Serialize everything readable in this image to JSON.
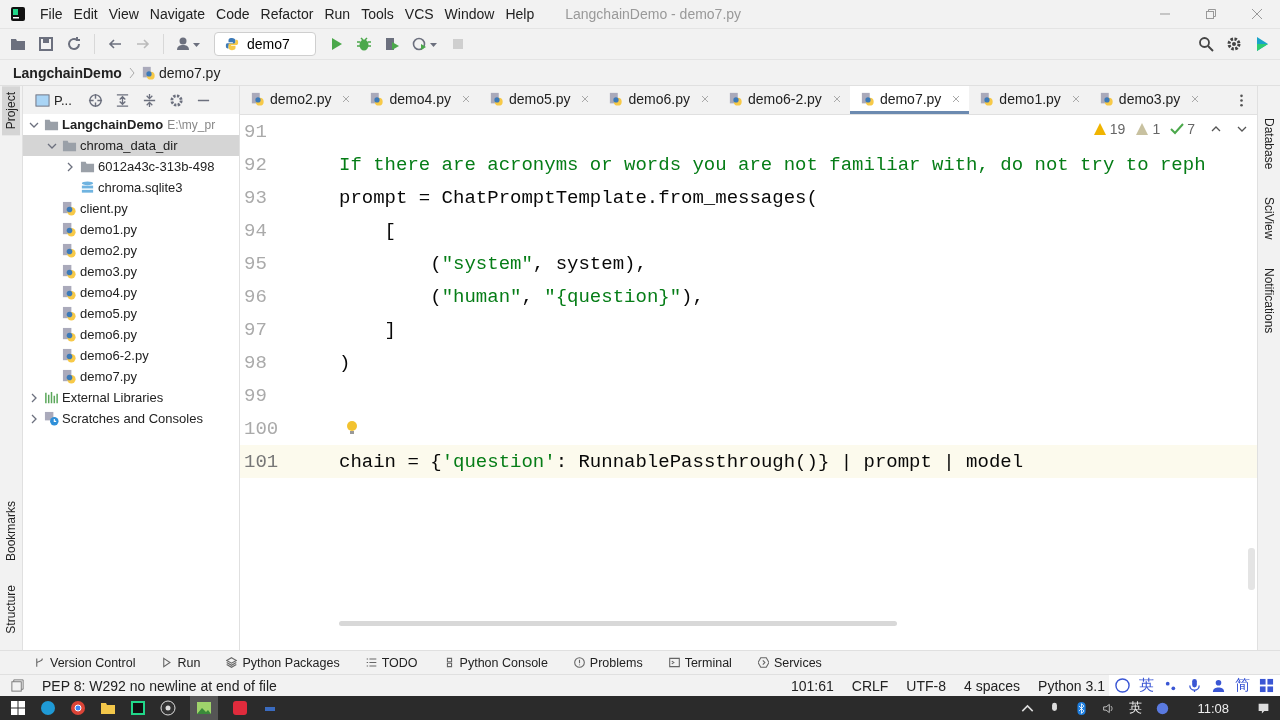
{
  "title_bar": {
    "menu": [
      "File",
      "Edit",
      "View",
      "Navigate",
      "Code",
      "Refactor",
      "Run",
      "Tools",
      "VCS",
      "Window",
      "Help"
    ],
    "title": "LangchainDemo - demo7.py"
  },
  "toolbar": {
    "run_config": "demo7"
  },
  "breadcrumb": [
    "LangchainDemo",
    "demo7.py"
  ],
  "left_strip": {
    "top": [
      {
        "label": "Project",
        "selected": true
      }
    ],
    "bottom": [
      {
        "label": "Bookmarks",
        "selected": false
      },
      {
        "label": "Structure",
        "selected": false
      }
    ]
  },
  "project_panel": {
    "title": "P...",
    "tree": [
      {
        "label": "LangchainDemo",
        "hint": "E:\\my_pr",
        "kind": "folder",
        "expanded": true,
        "selected": false,
        "children": [
          {
            "label": "chroma_data_dir",
            "kind": "folder",
            "expanded": true,
            "selected": true,
            "children": [
              {
                "label": "6012a43c-313b-498",
                "kind": "folder",
                "expanded": false,
                "selected": false
              },
              {
                "label": "chroma.sqlite3",
                "kind": "db",
                "selected": false
              }
            ]
          },
          {
            "label": "client.py",
            "kind": "py",
            "selected": false
          },
          {
            "label": "demo1.py",
            "kind": "py",
            "selected": false
          },
          {
            "label": "demo2.py",
            "kind": "py",
            "selected": false
          },
          {
            "label": "demo3.py",
            "kind": "py",
            "selected": false
          },
          {
            "label": "demo4.py",
            "kind": "py",
            "selected": false
          },
          {
            "label": "demo5.py",
            "kind": "py",
            "selected": false
          },
          {
            "label": "demo6.py",
            "kind": "py",
            "selected": false
          },
          {
            "label": "demo6-2.py",
            "kind": "py",
            "selected": false
          },
          {
            "label": "demo7.py",
            "kind": "py",
            "selected": false
          }
        ]
      },
      {
        "label": "External Libraries",
        "kind": "library",
        "expanded": false,
        "selected": false
      },
      {
        "label": "Scratches and Consoles",
        "kind": "scratches",
        "expanded": false,
        "selected": false
      }
    ]
  },
  "editor": {
    "tabs": [
      {
        "label": "demo2.py",
        "selected": false
      },
      {
        "label": "demo4.py",
        "selected": false
      },
      {
        "label": "demo5.py",
        "selected": false
      },
      {
        "label": "demo6.py",
        "selected": false
      },
      {
        "label": "demo6-2.py",
        "selected": false
      },
      {
        "label": "demo7.py",
        "selected": true
      },
      {
        "label": "demo1.py",
        "selected": false
      },
      {
        "label": "demo3.py",
        "selected": false
      }
    ],
    "inspections": {
      "warnings": "19",
      "weak_warnings": "1",
      "typos": "7"
    },
    "lines": [
      {
        "number": "91",
        "current": false
      },
      {
        "number": "92",
        "current": false,
        "segments": [
          {
            "kind": "string",
            "text": "If there are acronyms or words you are not familiar with, do not try to reph"
          }
        ]
      },
      {
        "number": "93",
        "current": false,
        "segments": [
          {
            "kind": "plain",
            "text": "prompt = ChatPromptTemplate.from_messages("
          }
        ]
      },
      {
        "number": "94",
        "current": false,
        "segments": [
          {
            "kind": "plain",
            "text": "    ["
          }
        ]
      },
      {
        "number": "95",
        "current": false,
        "segments": [
          {
            "kind": "plain",
            "text": "        ("
          },
          {
            "kind": "string",
            "text": "\"system\""
          },
          {
            "kind": "plain",
            "text": ", system),"
          }
        ]
      },
      {
        "number": "96",
        "current": false,
        "segments": [
          {
            "kind": "plain",
            "text": "        ("
          },
          {
            "kind": "string",
            "text": "\"human\""
          },
          {
            "kind": "plain",
            "text": ", "
          },
          {
            "kind": "string",
            "text": "\"{question}\""
          },
          {
            "kind": "plain",
            "text": "),"
          }
        ]
      },
      {
        "number": "97",
        "current": false,
        "segments": [
          {
            "kind": "plain",
            "text": "    ]"
          }
        ]
      },
      {
        "number": "98",
        "current": false,
        "segments": [
          {
            "kind": "plain",
            "text": ")"
          }
        ]
      },
      {
        "number": "99",
        "current": false
      },
      {
        "number": "100",
        "current": false
      },
      {
        "number": "101",
        "current": true,
        "segments": [
          {
            "kind": "plain",
            "text": "chain = {"
          },
          {
            "kind": "string",
            "text": "'question'"
          },
          {
            "kind": "plain",
            "text": ": RunnablePassthrough()} | prompt | model"
          }
        ]
      }
    ]
  },
  "right_strip": [
    "Database",
    "SciView",
    "Notifications"
  ],
  "tool_windows": [
    {
      "label": "Version Control",
      "kind": "vcs"
    },
    {
      "label": "Run",
      "kind": "run"
    },
    {
      "label": "Python Packages",
      "kind": "packages"
    },
    {
      "label": "TODO",
      "kind": "todo"
    },
    {
      "label": "Python Console",
      "kind": "console"
    },
    {
      "label": "Problems",
      "kind": "problems"
    },
    {
      "label": "Terminal",
      "kind": "terminal"
    },
    {
      "label": "Services",
      "kind": "services"
    }
  ],
  "status_bar": {
    "message": "PEP 8: W292 no newline at end of file",
    "items": [
      "101:61",
      "CRLF",
      "UTF-8",
      "4 spaces",
      "Python 3.1"
    ],
    "ime": [
      "英",
      "简"
    ]
  },
  "taskbar": {
    "ime": "英",
    "time": "11:08"
  }
}
